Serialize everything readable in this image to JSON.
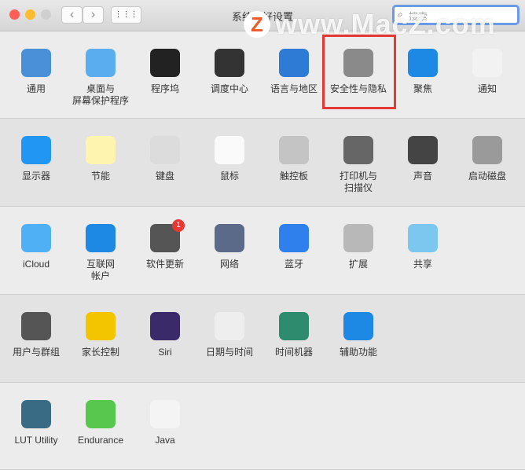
{
  "window": {
    "title": "系统偏好设置",
    "search_placeholder": "搜索",
    "back": "‹",
    "forward": "›",
    "grid": "⋮⋮⋮"
  },
  "watermark": {
    "z": "Z",
    "text": "www.MacZ.com"
  },
  "sections": [
    {
      "items": [
        {
          "label": "通用",
          "icon": "general-icon",
          "color": "#4a90d9"
        },
        {
          "label": "桌面与\n屏幕保护程序",
          "icon": "desktop-icon",
          "color": "#5aaef0"
        },
        {
          "label": "程序坞",
          "icon": "dock-icon",
          "color": "#222"
        },
        {
          "label": "调度中心",
          "icon": "mission-control-icon",
          "color": "#333"
        },
        {
          "label": "语言与地区",
          "icon": "language-flag-icon",
          "color": "#2e7bd6"
        },
        {
          "label": "安全性与隐私",
          "icon": "security-house-icon",
          "color": "#8a8a8a"
        },
        {
          "label": "聚焦",
          "icon": "spotlight-icon",
          "color": "#1e88e5"
        },
        {
          "label": "通知",
          "icon": "notifications-icon",
          "color": "#f2f2f2"
        }
      ]
    },
    {
      "items": [
        {
          "label": "显示器",
          "icon": "display-icon",
          "color": "#2196f3"
        },
        {
          "label": "节能",
          "icon": "bulb-icon",
          "color": "#fff3b0"
        },
        {
          "label": "键盘",
          "icon": "keyboard-icon",
          "color": "#dcdcdc"
        },
        {
          "label": "鼠标",
          "icon": "mouse-icon",
          "color": "#fafafa"
        },
        {
          "label": "触控板",
          "icon": "trackpad-icon",
          "color": "#c4c4c4"
        },
        {
          "label": "打印机与\n扫描仪",
          "icon": "printer-icon",
          "color": "#666"
        },
        {
          "label": "声音",
          "icon": "speaker-icon",
          "color": "#444"
        },
        {
          "label": "启动磁盘",
          "icon": "disk-icon",
          "color": "#9a9a9a"
        }
      ]
    },
    {
      "items": [
        {
          "label": "iCloud",
          "icon": "icloud-icon",
          "color": "#4fb0f5"
        },
        {
          "label": "互联网\n帐户",
          "icon": "at-icon",
          "color": "#1e88e5"
        },
        {
          "label": "软件更新",
          "icon": "software-update-gear-icon",
          "color": "#555",
          "badge": "1"
        },
        {
          "label": "网络",
          "icon": "network-globe-icon",
          "color": "#5c6a8a"
        },
        {
          "label": "蓝牙",
          "icon": "bluetooth-icon",
          "color": "#2f80ed"
        },
        {
          "label": "扩展",
          "icon": "puzzle-icon",
          "color": "#b8b8b8"
        },
        {
          "label": "共享",
          "icon": "sharing-folder-icon",
          "color": "#7cc7f0"
        }
      ]
    },
    {
      "items": [
        {
          "label": "用户与群组",
          "icon": "users-icon",
          "color": "#555"
        },
        {
          "label": "家长控制",
          "icon": "parental-icon",
          "color": "#f2c500"
        },
        {
          "label": "Siri",
          "icon": "siri-icon",
          "color": "#3a2a6a"
        },
        {
          "label": "日期与时间",
          "icon": "clock-icon",
          "color": "#eee"
        },
        {
          "label": "时间机器",
          "icon": "time-machine-icon",
          "color": "#2e8b6e"
        },
        {
          "label": "辅助功能",
          "icon": "accessibility-icon",
          "color": "#1e88e5"
        }
      ]
    },
    {
      "items": [
        {
          "label": "LUT Utility",
          "icon": "lut-icon",
          "color": "#3a6b84"
        },
        {
          "label": "Endurance",
          "icon": "battery-icon",
          "color": "#57c84d"
        },
        {
          "label": "Java",
          "icon": "java-icon",
          "color": "#f4f4f4"
        }
      ]
    }
  ]
}
